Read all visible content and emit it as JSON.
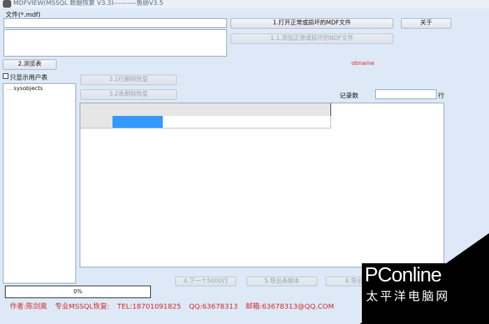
{
  "window": {
    "title": "MDFVIEW(MSSQL 数据恢复 V3.3)----------鱼肠V3.5"
  },
  "file": {
    "label": "文件(*.mdf)",
    "path_value": "",
    "list_value": ""
  },
  "buttons": {
    "open_mdf": "1.打开正常或损坏的MDF文件",
    "add_ndf": "1.1.添加正常或损坏的NDF文件",
    "about": "关于",
    "browse_tables": "2.浏览表",
    "restore_deleted_rows": "3.1行删除恢复",
    "restore_deleted_table": "3.2表删除恢复",
    "next_5000_rows": "4.下一个5000行",
    "export_table_script": "5.导出表脚本",
    "export_table_data": "6.导出表"
  },
  "objname": "obname",
  "user_tables_only": {
    "label": "只显示用户表",
    "checked": false
  },
  "tree": {
    "items": [
      "sysobjects"
    ]
  },
  "record_count": {
    "label": "记录数",
    "value": "",
    "unit": "行"
  },
  "grid": {
    "columns": [
      "",
      "",
      "",
      "",
      ""
    ],
    "rows": [
      [
        "",
        "",
        "",
        "",
        ""
      ]
    ]
  },
  "progress": {
    "text": "0%",
    "fraction": 0.0
  },
  "footer": {
    "author": "作者:陈剑嵩",
    "specialty": "专业MSSQL恢复:",
    "tel": "TEL:18701091825",
    "qq": "QQ:63678313",
    "email": "邮箱:63678313@QQ.COM"
  },
  "watermark": {
    "logo": "PConline",
    "subtitle": "太平洋电脑网"
  },
  "colors": {
    "background": "#dde9f6",
    "footer_text": "#d8262a",
    "selected_cell": "#3399ff"
  }
}
